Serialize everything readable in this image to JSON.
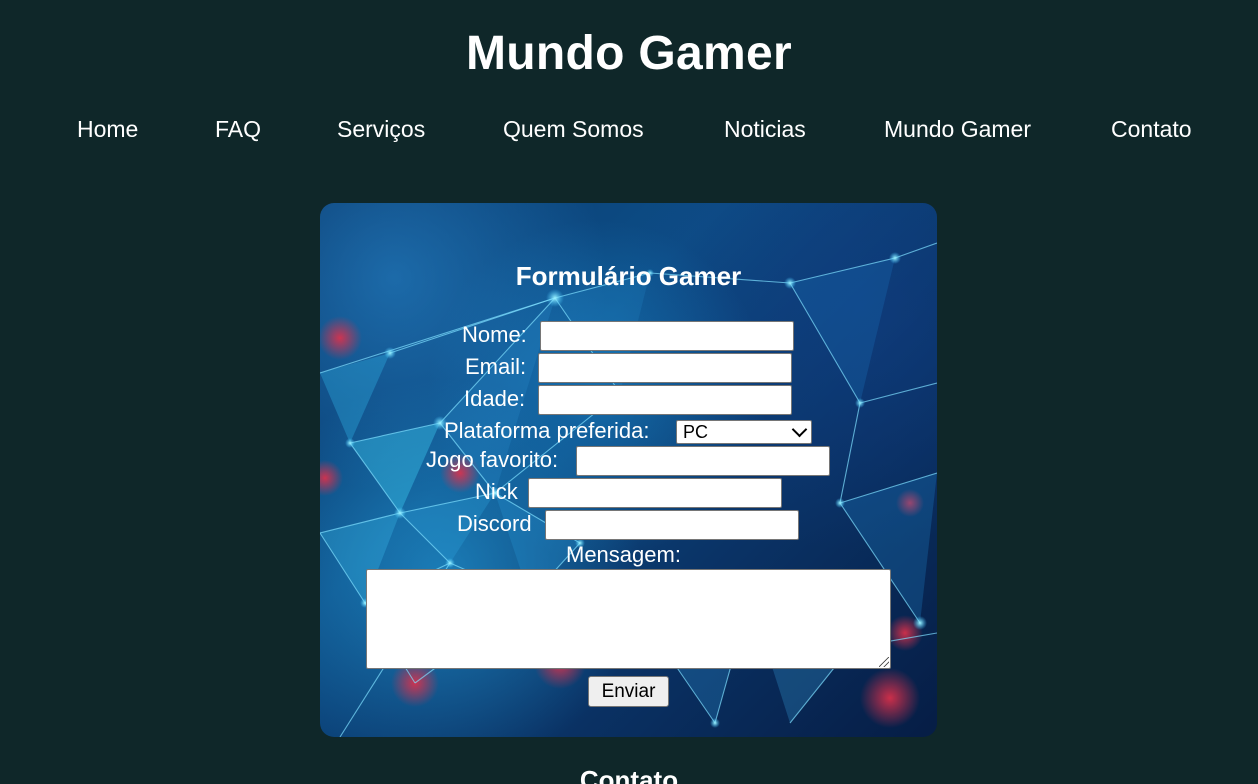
{
  "site": {
    "title": "Mundo Gamer"
  },
  "nav": {
    "items": [
      "Home",
      "FAQ",
      "Serviços",
      "Quem Somos",
      "Noticias",
      "Mundo Gamer",
      "Contato"
    ]
  },
  "form": {
    "title": "Formulário Gamer",
    "fields": {
      "nome_label": "Nome:",
      "nome_value": "",
      "email_label": "Email:",
      "email_value": "",
      "idade_label": "Idade:",
      "idade_value": "",
      "plataforma_label": "Plataforma preferida:",
      "plataforma_selected": "PC",
      "jogo_label": "Jogo favorito:",
      "jogo_value": "",
      "nick_label": "Nick",
      "nick_value": "",
      "discord_label": "Discord",
      "discord_value": "",
      "mensagem_label": "Mensagem:",
      "mensagem_value": ""
    },
    "submit_label": "Enviar"
  },
  "section": {
    "contact_heading": "Contato"
  },
  "icons": {
    "select_arrow": "chevron-down-icon",
    "textarea_resize": "resize-grip-icon"
  },
  "colors": {
    "page_background": "#0f2729",
    "text": "#ffffff",
    "form_background": "#0d4d86"
  }
}
